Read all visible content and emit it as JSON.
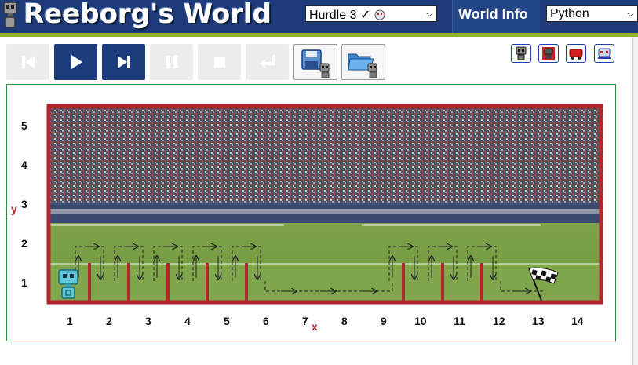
{
  "app": {
    "title": "Reeborg's World",
    "world_select": {
      "value": "Hurdle 3 ✓"
    },
    "world_info_label": "World Info",
    "language_select": {
      "value": "Python"
    }
  },
  "controls": {
    "buttons": [
      {
        "name": "reload-button",
        "enabled": false,
        "icon": "skip-back-icon"
      },
      {
        "name": "run-button",
        "enabled": true,
        "icon": "play-icon"
      },
      {
        "name": "step-button",
        "enabled": true,
        "icon": "step-forward-icon"
      },
      {
        "name": "pause-button",
        "enabled": false,
        "icon": "pause-icon"
      },
      {
        "name": "stop-button",
        "enabled": false,
        "icon": "stop-icon"
      },
      {
        "name": "return-button",
        "enabled": false,
        "icon": "return-icon"
      }
    ],
    "file_buttons": [
      "save-robot-icon",
      "open-robot-icon"
    ],
    "right_buttons": [
      "robot-icon",
      "robot-red-icon",
      "red-robot-flip-icon",
      "robot-traced-icon"
    ]
  },
  "world": {
    "rows": 5,
    "columns": 14,
    "x_label": "x",
    "y_label": "y",
    "x_ticks": [
      "1",
      "2",
      "3",
      "4",
      "5",
      "6",
      "7",
      "8",
      "9",
      "10",
      "11",
      "12",
      "13",
      "14"
    ],
    "y_ticks": [
      "1",
      "2",
      "3",
      "4",
      "5"
    ],
    "background": "stadium-photo",
    "robot_position": [
      1,
      1
    ],
    "goal_position": [
      13,
      1
    ],
    "hurdles_x": [
      1,
      2,
      3,
      4,
      5,
      9,
      10,
      11
    ]
  },
  "colors": {
    "header": "#1f3a78",
    "accent_green": "#8fb32a",
    "wall_red": "#b3262b",
    "active_button": "#1c3c7c"
  }
}
